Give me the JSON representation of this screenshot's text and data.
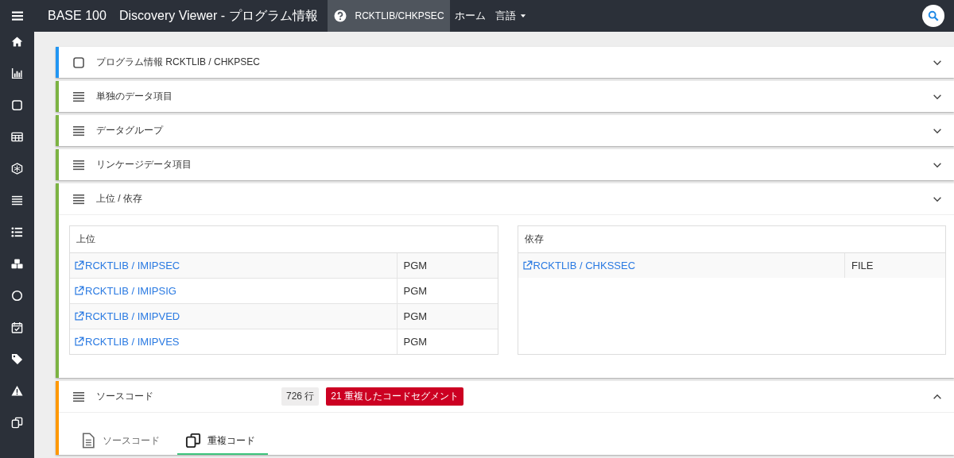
{
  "topbar": {
    "brand": "BASE 100",
    "title": "Discovery Viewer - プログラム情報",
    "nav": [
      {
        "label": "RCKTLIB/CHKPSEC",
        "kind": "help",
        "selected": true
      },
      {
        "label": "ホーム",
        "kind": "plain",
        "selected": false
      },
      {
        "label": "言語",
        "kind": "dropdown",
        "selected": false
      }
    ]
  },
  "sidebar": {
    "items": [
      {
        "kind": "home"
      },
      {
        "kind": "chart"
      },
      {
        "kind": "square"
      },
      {
        "kind": "table"
      },
      {
        "kind": "hexagon"
      },
      {
        "kind": "lines"
      },
      {
        "kind": "list"
      },
      {
        "kind": "cubes"
      },
      {
        "kind": "circle"
      },
      {
        "kind": "calendar"
      },
      {
        "kind": "tag"
      },
      {
        "kind": "warning"
      },
      {
        "kind": "copy"
      }
    ]
  },
  "panels": [
    {
      "title": "プログラム情報 RCKTLIB / CHKPSEC",
      "kind": "square",
      "color": "#2196f3",
      "chevron_up": false
    },
    {
      "title": "単独のデータ項目",
      "kind": "lines",
      "color": "#7cb342",
      "chevron_up": false
    },
    {
      "title": "データグループ",
      "kind": "lines",
      "color": "#7cb342",
      "chevron_up": false
    },
    {
      "title": "リンケージデータ項目",
      "kind": "lines",
      "color": "#7cb342",
      "chevron_up": false
    },
    {
      "title": "上位 / 依存",
      "kind": "lines",
      "color": "#7cb342",
      "chevron_up": false,
      "body": {
        "kind": "tables",
        "tables": [
          {
            "heading": "上位",
            "rows": [
              {
                "link": "RCKTLIB / IMIPSEC",
                "type": "PGM"
              },
              {
                "link": "RCKTLIB / IMIPSIG",
                "type": "PGM"
              },
              {
                "link": "RCKTLIB / IMIPVED",
                "type": "PGM"
              },
              {
                "link": "RCKTLIB / IMIPVES",
                "type": "PGM"
              }
            ]
          },
          {
            "heading": "依存",
            "rows": [
              {
                "link": "RCKTLIB / CHKSSEC",
                "type": "FILE"
              }
            ]
          }
        ]
      }
    },
    {
      "title": "ソースコード",
      "kind": "lines",
      "color": "#ff9800",
      "chevron_up": true,
      "badges": [
        {
          "text": "726 行",
          "kind": "count"
        },
        {
          "text": "21 重複したコードセグメント",
          "kind": "alert"
        }
      ],
      "body": {
        "kind": "tabs",
        "tabs": [
          {
            "label": "ソースコード",
            "kind": "file",
            "selected": false
          },
          {
            "label": "重複コード",
            "kind": "copy",
            "selected": true
          }
        ]
      }
    }
  ]
}
